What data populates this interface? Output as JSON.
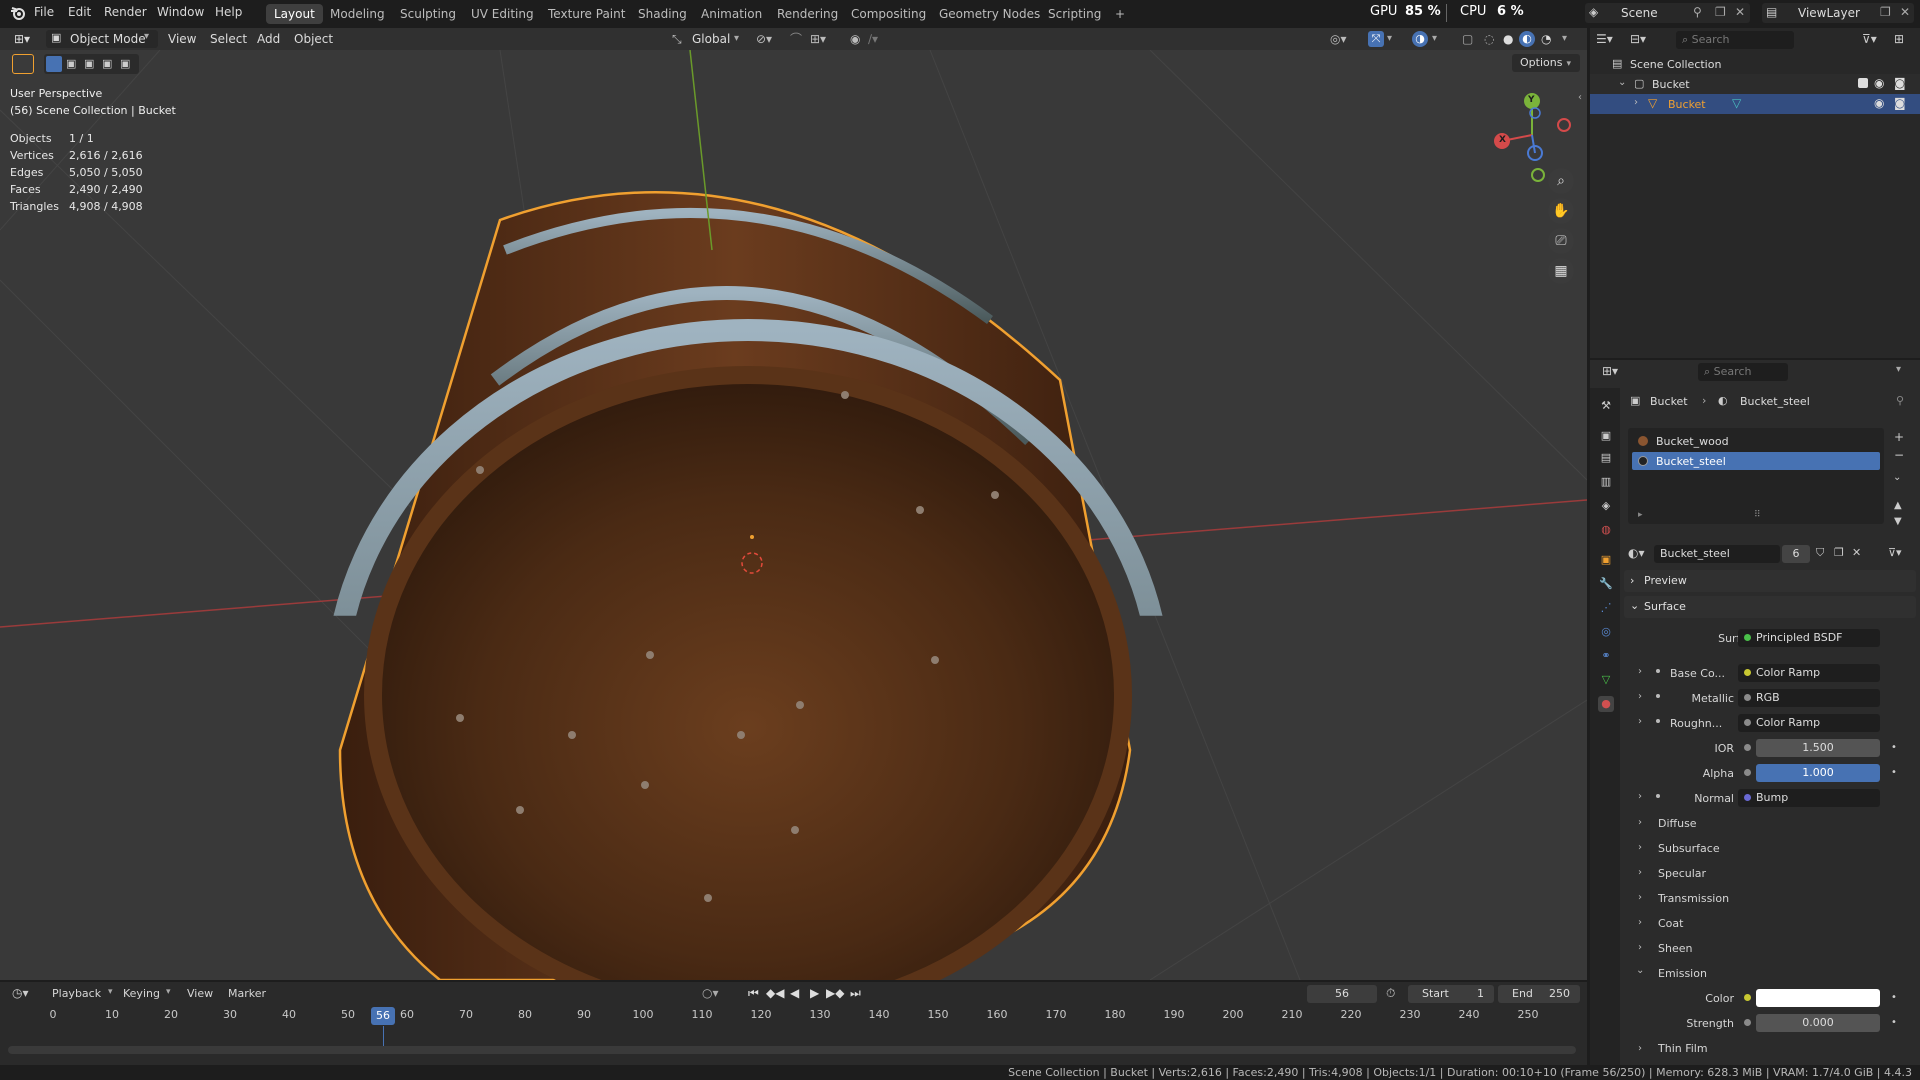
{
  "menus": [
    "File",
    "Edit",
    "Render",
    "Window",
    "Help"
  ],
  "workspaces": [
    "Layout",
    "Modeling",
    "Sculpting",
    "UV Editing",
    "Texture Paint",
    "Shading",
    "Animation",
    "Rendering",
    "Compositing",
    "Geometry Nodes",
    "Scripting"
  ],
  "workspace_add": "+",
  "gpu": {
    "label": "GPU",
    "value": "85 %"
  },
  "cpu": {
    "label": "CPU",
    "value": "6 %"
  },
  "scene": {
    "name": "Scene",
    "view_layer": "ViewLayer"
  },
  "viewport": {
    "mode": "Object Mode",
    "menu": [
      "View",
      "Select",
      "Add",
      "Object"
    ],
    "orientation": "Global",
    "options": "Options",
    "perspective": "User Perspective",
    "collection_path": "(56) Scene Collection | Bucket",
    "stats": [
      {
        "label": "Objects",
        "value": "1 / 1"
      },
      {
        "label": "Vertices",
        "value": "2,616 / 2,616"
      },
      {
        "label": "Edges",
        "value": "5,050 / 5,050"
      },
      {
        "label": "Faces",
        "value": "2,490 / 2,490"
      },
      {
        "label": "Triangles",
        "value": "4,908 / 4,908"
      }
    ],
    "gizmo": {
      "y": "Y",
      "x": "X"
    }
  },
  "outliner": {
    "search_placeholder": "Search",
    "root": "Scene Collection",
    "collection": "Bucket",
    "object": "Bucket"
  },
  "properties": {
    "search_placeholder": "Search",
    "breadcrumb": [
      "Bucket",
      "Bucket_steel"
    ],
    "slots": [
      "Bucket_wood",
      "Bucket_steel"
    ],
    "material_name": "Bucket_steel",
    "users": "6",
    "panels": {
      "preview": "Preview",
      "surface": "Surface"
    },
    "surface_label": "Surface",
    "surface_value": "Principled BSDF",
    "inputs": [
      {
        "label": "Base Co...",
        "value": "Color Ramp",
        "color": "#c8c832"
      },
      {
        "label": "Metallic",
        "value": "RGB",
        "color": "#8a8a8a"
      },
      {
        "label": "Roughn...",
        "value": "Color Ramp",
        "color": "#8a8a8a"
      }
    ],
    "ior": {
      "label": "IOR",
      "value": "1.500"
    },
    "alpha": {
      "label": "Alpha",
      "value": "1.000"
    },
    "normal": {
      "label": "Normal",
      "value": "Bump"
    },
    "subpanels": [
      "Diffuse",
      "Subsurface",
      "Specular",
      "Transmission",
      "Coat",
      "Sheen",
      "Emission",
      "Thin Film"
    ],
    "emission_color_label": "Color",
    "emission_strength": {
      "label": "Strength",
      "value": "0.000"
    }
  },
  "timeline": {
    "menu": [
      "Playback",
      "Keying",
      "View",
      "Marker"
    ],
    "current_frame": "56",
    "start_label": "Start",
    "start": "1",
    "end_label": "End",
    "end": "250",
    "ticks": [
      "0",
      "10",
      "20",
      "30",
      "40",
      "50",
      "60",
      "70",
      "80",
      "90",
      "100",
      "110",
      "120",
      "130",
      "140",
      "150",
      "160",
      "170",
      "180",
      "190",
      "200",
      "210",
      "220",
      "230",
      "240",
      "250"
    ]
  },
  "status": "Scene Collection | Bucket | Verts:2,616 | Faces:2,490 | Tris:4,908 | Objects:1/1 | Duration: 00:10+10 (Frame 56/250) | Memory: 628.3 MiB | VRAM: 1.7/4.0 GiB | 4.4.3",
  "colors": {
    "accent": "#4772b3",
    "selection": "#f0a030",
    "wood": "#6b3d1f"
  }
}
